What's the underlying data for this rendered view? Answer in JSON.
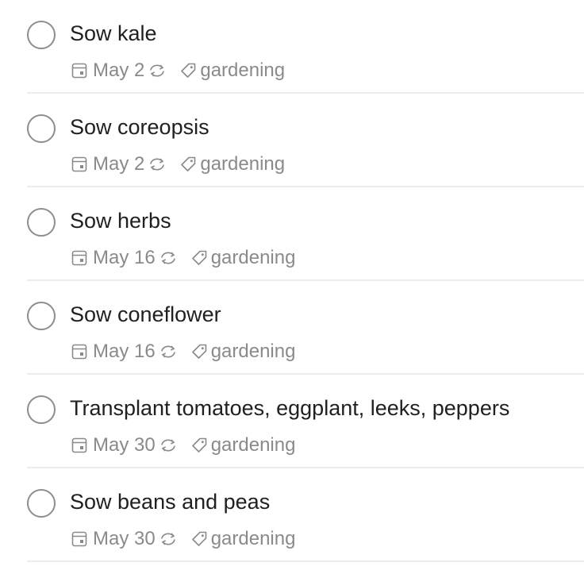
{
  "tasks": [
    {
      "title": "Sow kale",
      "due": "May 2",
      "label": "gardening"
    },
    {
      "title": "Sow coreopsis",
      "due": "May 2",
      "label": "gardening"
    },
    {
      "title": "Sow herbs",
      "due": "May 16",
      "label": "gardening"
    },
    {
      "title": "Sow coneflower",
      "due": "May 16",
      "label": "gardening"
    },
    {
      "title": "Transplant tomatoes, eggplant, leeks, peppers",
      "due": "May 30",
      "label": "gardening"
    },
    {
      "title": "Sow beans and peas",
      "due": "May 30",
      "label": "gardening"
    }
  ],
  "icons": {
    "checkbox": "circle-checkbox-icon",
    "due": "calendar-icon",
    "recurring": "repeat-icon",
    "label": "tag-icon"
  },
  "colors": {
    "title_text": "#202020",
    "meta_text": "#8a8a8a",
    "checkbox_border": "#8e8e8e",
    "divider": "#ececec"
  }
}
